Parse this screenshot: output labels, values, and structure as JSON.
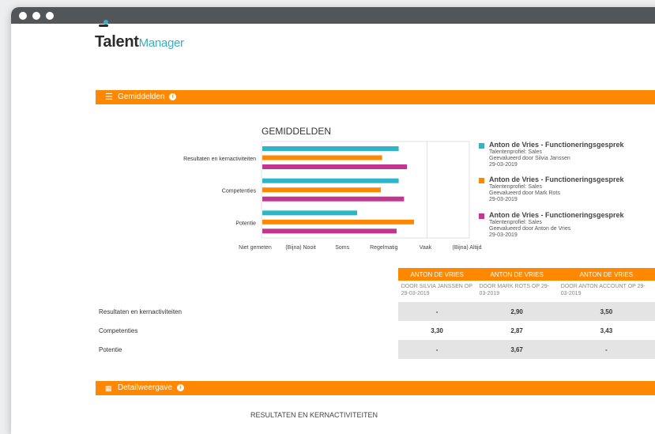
{
  "logo": {
    "brand": "Talent",
    "product": "Manager"
  },
  "sections": {
    "averages_title": "Gemiddelden",
    "detail_title": "Detailweergave"
  },
  "icons": {
    "menu": "hamburger-menu-icon",
    "info": "info-icon",
    "chart": "bar-chart-icon"
  },
  "colors": {
    "accent": "#ff8800",
    "series1": "#2eb6c8",
    "series2": "#ff8800",
    "series3": "#c2368f"
  },
  "chart_data": {
    "type": "bar",
    "orientation": "horizontal",
    "title": "GEMIDDELDEN",
    "categories": [
      "Resultaten en kernactiviteiten",
      "Competenties",
      "Potentie"
    ],
    "x_tick_labels": [
      "Niet gemeten",
      "(Bijna) Nooit",
      "Soms",
      "Regelmatig",
      "Vaak",
      "(Bijna) Altijd"
    ],
    "xlim": [
      0,
      5
    ],
    "grid": true,
    "legend_position": "right",
    "series": [
      {
        "name": "Anton de Vries - Functioneringsgesprek",
        "values": [
          3.3,
          3.3,
          2.3
        ]
      },
      {
        "name": "Anton de Vries - Functioneringsgesprek",
        "values": [
          2.9,
          2.87,
          3.67
        ]
      },
      {
        "name": "Anton de Vries - Functioneringsgesprek",
        "values": [
          3.5,
          3.43,
          3.25
        ]
      }
    ]
  },
  "legend": [
    {
      "title": "Anton de Vries - Functioneringsgesprek",
      "profile": "Talentenprofiel: Sales",
      "by": "Geevalueerd door Silvia Janssen",
      "date": "29-03-2019"
    },
    {
      "title": "Anton de Vries - Functioneringsgesprek",
      "profile": "Talentenprofiel: Sales",
      "by": "Geevalueerd door Mark Rots",
      "date": "29-03-2019"
    },
    {
      "title": "Anton de Vries - Functioneringsgesprek",
      "profile": "Talentenprofiel: Sales",
      "by": "Geevalueerd door Anton de Vries",
      "date": "29-03-2019"
    }
  ],
  "table": {
    "columns": [
      {
        "name": "ANTON DE VRIES",
        "sub": "DOOR SILVIA JANSSEN OP 29-03-2019"
      },
      {
        "name": "ANTON DE VRIES",
        "sub": "DOOR MARK ROTS OP 29-03-2019"
      },
      {
        "name": "ANTON DE VRIES",
        "sub": "DOOR ANTON ACCOUNT OP 29-03-2019"
      }
    ],
    "rows": [
      {
        "label": "Resultaten en kernactiviteiten",
        "values": [
          "-",
          "2,90",
          "3,50"
        ]
      },
      {
        "label": "Competenties",
        "values": [
          "3,30",
          "2,87",
          "3,43"
        ]
      },
      {
        "label": "Potentie",
        "values": [
          "-",
          "3,67",
          "-"
        ]
      }
    ]
  },
  "detail_chart_title": "RESULTATEN EN KERNACTIVITEITEN"
}
